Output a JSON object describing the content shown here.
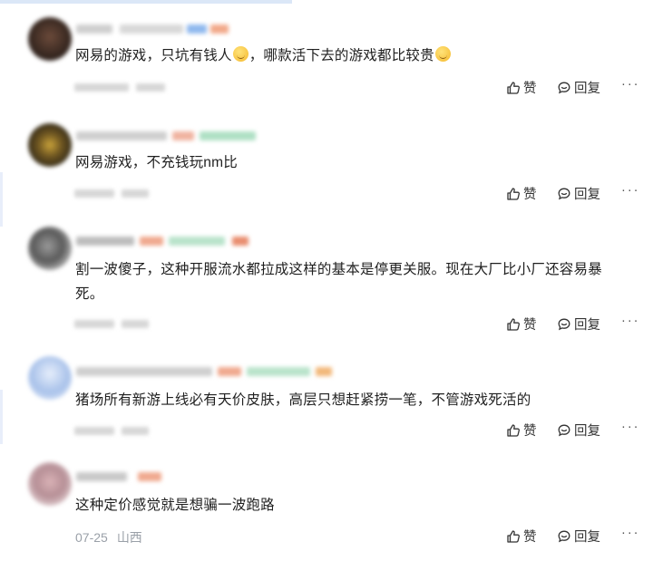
{
  "comments": [
    {
      "text_a": "网易的游戏，只坑有钱人",
      "text_b": "，哪款活下去的游戏都比较贵",
      "emojis": 2,
      "like_label": "赞",
      "reply_label": "回复",
      "more_label": "···"
    },
    {
      "text": "网易游戏，不充钱玩nm比",
      "like_label": "赞",
      "reply_label": "回复",
      "more_label": "···"
    },
    {
      "text": "割一波傻子，这种开服流水都拉成这样的基本是停更关服。现在大厂比小厂还容易暴死。",
      "like_label": "赞",
      "reply_label": "回复",
      "more_label": "···"
    },
    {
      "text": "猪场所有新游上线必有天价皮肤，高层只想赶紧捞一笔，不管游戏死活的",
      "like_label": "赞",
      "reply_label": "回复",
      "more_label": "···"
    },
    {
      "text": "这种定价感觉就是想骗一波跑路",
      "date": "07-25",
      "location": "山西",
      "like_label": "赞",
      "reply_label": "回复",
      "more_label": "···"
    }
  ],
  "colors": {
    "meta_gray": "#9aa0a8",
    "text": "#1f1f1f",
    "action": "#333333"
  },
  "icons": [
    "thumbs-up-icon",
    "chat-bubble-icon",
    "more-dots-icon"
  ]
}
